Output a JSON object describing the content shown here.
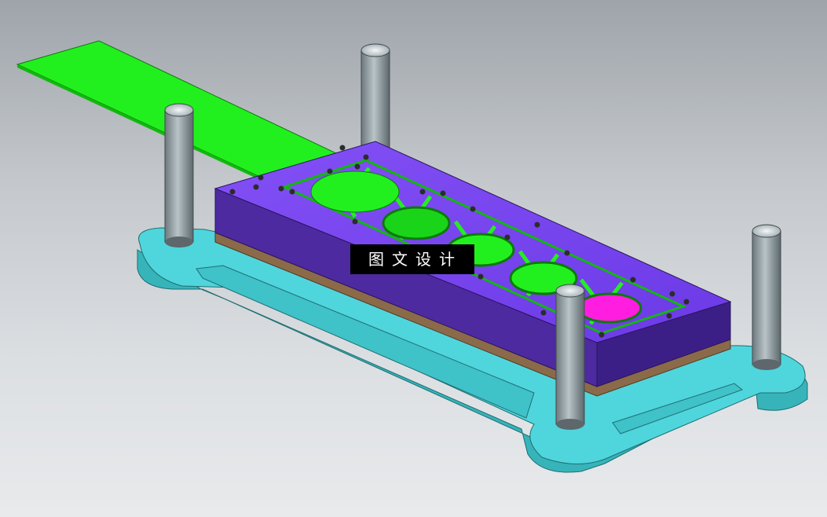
{
  "watermark": {
    "text": "图文设计"
  },
  "colors": {
    "background_top": "#9ea4aa",
    "background_bottom": "#e8eaec",
    "base_plate": "#4fd6dc",
    "base_plate_side": "#36b4ba",
    "die_top": "#7a46f0",
    "die_side": "#4e2aa0",
    "die_side_dark": "#3c1f86",
    "backing_plate": "#8b6a4a",
    "strip": "#22f01e",
    "strip_dark": "#12b80f",
    "guide_post": "#7e8a90",
    "guide_post_light": "#b4c0c4",
    "hole_highlight": "#ff1ee0"
  }
}
